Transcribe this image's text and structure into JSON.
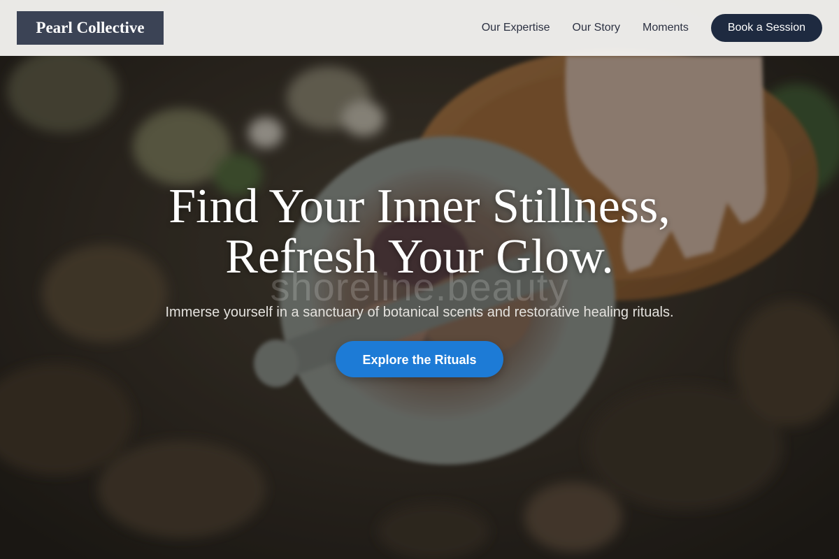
{
  "header": {
    "logo": "Pearl Collective",
    "nav": [
      {
        "label": "Our Expertise"
      },
      {
        "label": "Our Story"
      },
      {
        "label": "Moments"
      }
    ],
    "cta_label": "Book a Session"
  },
  "hero": {
    "title_line1": "Find Your Inner Stillness,",
    "title_line2": "Refresh Your Glow.",
    "subtitle": "Immerse yourself in a sanctuary of botanical scents and restorative healing rituals.",
    "button_label": "Explore the Rituals",
    "watermark": "shoreline.beauty"
  },
  "colors": {
    "header_bg": "#f2f1ef",
    "logo_bg": "#3b4355",
    "book_button_bg": "#1e2a40",
    "cta_bg": "#1d7bd6",
    "nav_text": "#2c3142"
  }
}
